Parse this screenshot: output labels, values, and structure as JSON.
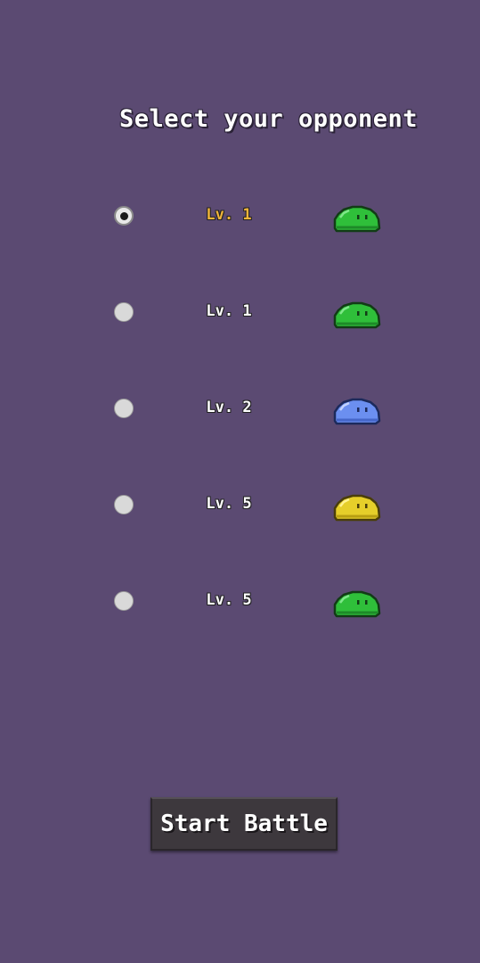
{
  "screen": {
    "title": "Select your opponent"
  },
  "opponents": [
    {
      "level": "Lv. 1",
      "slime": "green-slime-icon",
      "color": "#2fbf3a",
      "selected": true
    },
    {
      "level": "Lv. 1",
      "slime": "green-slime-icon",
      "color": "#2fbf3a",
      "selected": false
    },
    {
      "level": "Lv. 2",
      "slime": "blue-slime-icon",
      "color": "#6b8ff0",
      "selected": false
    },
    {
      "level": "Lv. 5",
      "slime": "yellow-slime-icon",
      "color": "#e6cf2a",
      "selected": false
    },
    {
      "level": "Lv. 5",
      "slime": "green-slime-icon",
      "color": "#2fbf3a",
      "selected": false
    }
  ],
  "start_button": {
    "label": "Start Battle"
  },
  "colors": {
    "background": "#5b4a72",
    "selected_level": "#f0b43a"
  }
}
